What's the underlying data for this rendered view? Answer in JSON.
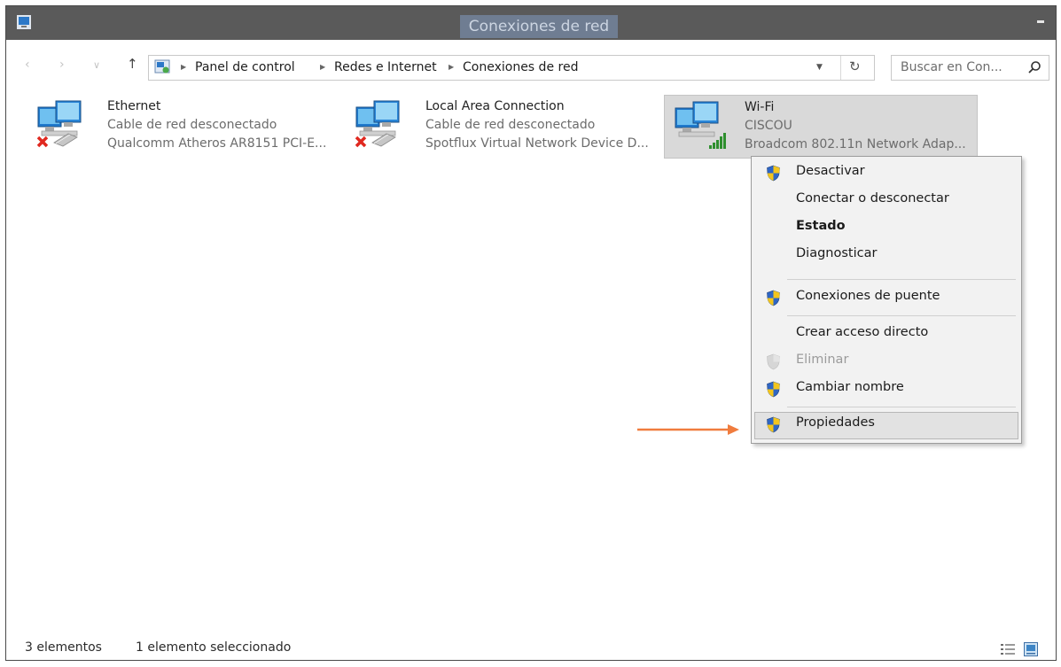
{
  "window": {
    "title": "Conexiones de red"
  },
  "navbar": {
    "back_icon": "‹",
    "forward_icon": "›",
    "recent_icon": "∨",
    "up_icon": "↑",
    "breadcrumbs": [
      "Panel de control",
      "Redes e Internet",
      "Conexiones de red"
    ],
    "search_placeholder": "Buscar en Con..."
  },
  "connections": [
    {
      "name": "Ethernet",
      "status": "Cable de red desconectado",
      "device": "Qualcomm Atheros AR8151 PCI-E...",
      "icon": "wired-disconnected-icon"
    },
    {
      "name": "Local Area Connection",
      "status": "Cable de red desconectado",
      "device": "Spotflux Virtual Network Device D...",
      "icon": "wired-disconnected-icon"
    },
    {
      "name": "Wi-Fi",
      "status": "CISCOU",
      "device": "Broadcom 802.11n Network Adap...",
      "icon": "wifi-signal-icon",
      "selected": true
    }
  ],
  "context_menu": {
    "items": [
      {
        "label": "Desactivar",
        "icon": "shield-icon"
      },
      {
        "label": "Conectar o desconectar"
      },
      {
        "label": "Estado",
        "bold": true
      },
      {
        "label": "Diagnosticar"
      },
      {
        "label": "Conexiones de puente",
        "icon": "shield-icon"
      },
      {
        "label": "Crear acceso directo"
      },
      {
        "label": "Eliminar",
        "icon": "shield-icon",
        "disabled": true
      },
      {
        "label": "Cambiar nombre",
        "icon": "shield-icon"
      },
      {
        "label": "Propiedades",
        "icon": "shield-icon",
        "hovered": true
      }
    ]
  },
  "status_bar": {
    "count": "3 elementos",
    "selection": "1 elemento seleccionado"
  },
  "colors": {
    "accent_arrow": "#f07c3e",
    "shield_blue": "#2f66c4",
    "shield_yellow": "#f3c51d"
  }
}
